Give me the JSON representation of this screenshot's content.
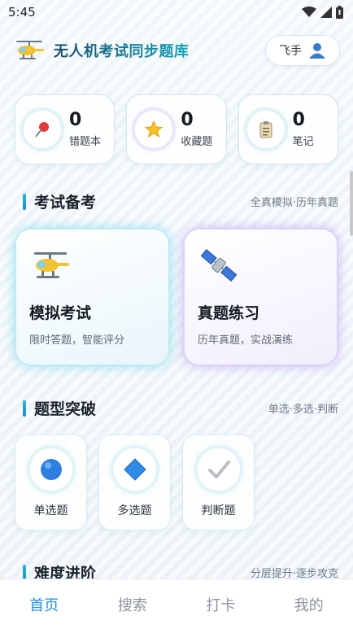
{
  "status": {
    "time": "5:45"
  },
  "header": {
    "title": "无人机考试同步题库",
    "logo_icon": "helicopter-icon",
    "user_label": "飞手",
    "user_icon": "user-icon"
  },
  "stats": [
    {
      "count": "0",
      "label": "错题本",
      "icon": "pushpin-icon"
    },
    {
      "count": "0",
      "label": "收藏题",
      "icon": "star-icon"
    },
    {
      "count": "0",
      "label": "笔记",
      "icon": "clipboard-icon"
    }
  ],
  "exam_section": {
    "title": "考试备考",
    "subtitle": "全真模拟·历年真题"
  },
  "exam_cards": [
    {
      "title": "模拟考试",
      "desc": "限时答题，智能评分",
      "icon": "helicopter-icon"
    },
    {
      "title": "真题练习",
      "desc": "历年真题，实战演练",
      "icon": "satellite-icon"
    }
  ],
  "qtype_section": {
    "title": "题型突破",
    "subtitle": "单选·多选·判断"
  },
  "qtypes": [
    {
      "label": "单选题",
      "icon": "blue-circle-icon"
    },
    {
      "label": "多选题",
      "icon": "blue-diamond-icon"
    },
    {
      "label": "判断题",
      "icon": "check-mark-icon"
    }
  ],
  "level_section": {
    "title": "难度进阶",
    "subtitle": "分层提升·逐步攻克"
  },
  "tabbar": {
    "items": [
      "首页",
      "搜索",
      "打卡",
      "我的"
    ],
    "active": "首页",
    "accent": "#1f8fe6"
  }
}
